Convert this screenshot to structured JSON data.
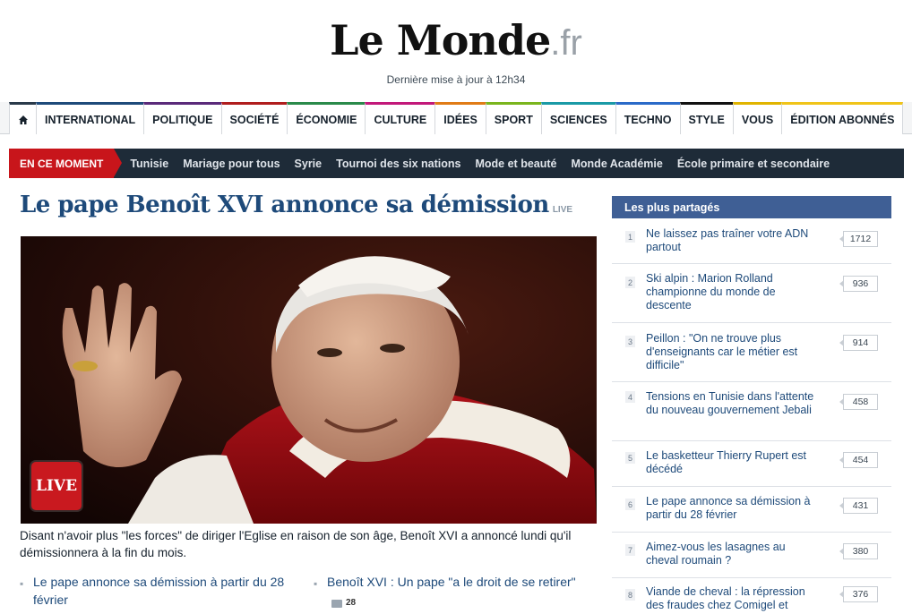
{
  "header": {
    "logo_main": "Le Monde",
    "logo_ext": ".fr",
    "updated": "Dernière mise à jour à 12h34"
  },
  "nav": {
    "home_icon": "home-icon",
    "items": [
      {
        "label": "INTERNATIONAL",
        "color": "#1e4a7a"
      },
      {
        "label": "POLITIQUE",
        "color": "#5a2a7a"
      },
      {
        "label": "SOCIÉTÉ",
        "color": "#b01d1d"
      },
      {
        "label": "ÉCONOMIE",
        "color": "#2a8a4a"
      },
      {
        "label": "CULTURE",
        "color": "#c2187a"
      },
      {
        "label": "IDÉES",
        "color": "#e07b16"
      },
      {
        "label": "SPORT",
        "color": "#7ab51d"
      },
      {
        "label": "SCIENCES",
        "color": "#1a9aa6"
      },
      {
        "label": "TECHNO",
        "color": "#2a6ac8"
      },
      {
        "label": "STYLE",
        "color": "#111111"
      },
      {
        "label": "VOUS",
        "color": "#e0b400"
      },
      {
        "label": "ÉDITION ABONNÉS",
        "color": "#f0c419"
      }
    ]
  },
  "moment": {
    "label": "EN CE MOMENT",
    "links": [
      "Tunisie",
      "Mariage pour tous",
      "Syrie",
      "Tournoi des six nations",
      "Mode et beauté",
      "Monde Académie",
      "École primaire et secondaire"
    ]
  },
  "article": {
    "title": "Le pape Benoît XVI annonce sa démission",
    "title_live": "LIVE",
    "badge": "LIVE",
    "summary": "Disant n'avoir plus \"les forces\" de diriger l'Eglise en raison de son âge, Benoît XVI a annoncé lundi qu'il démissionnera à la fin du mois.",
    "related": [
      {
        "text": "Le pape annonce sa démission à partir du 28 février"
      },
      {
        "text": "Benoît XVI : Un pape \"a le droit de se retirer\"",
        "comments": "28"
      }
    ]
  },
  "sidebar": {
    "title": "Les plus partagés",
    "items": [
      {
        "num": "1",
        "title": "Ne laissez pas traîner votre ADN partout",
        "count": "1712"
      },
      {
        "num": "2",
        "title": "Ski alpin : Marion Rolland championne du monde de descente",
        "count": "936"
      },
      {
        "num": "3",
        "title": "Peillon : \"On ne trouve plus d'enseignants car le métier est difficile\"",
        "count": "914"
      },
      {
        "num": "4",
        "title": "Tensions en Tunisie dans l'attente du nouveau gouvernement Jebali",
        "count": "458"
      },
      {
        "num": "5",
        "title": "Le basketteur Thierry Rupert est décédé",
        "count": "454"
      },
      {
        "num": "6",
        "title": "Le pape annonce sa démission à partir du 28 février",
        "count": "431"
      },
      {
        "num": "7",
        "title": "Aimez-vous les lasagnes au cheval roumain ?",
        "count": "380"
      },
      {
        "num": "8",
        "title": "Viande de cheval : la répression des fraudes chez Comigel et",
        "count": "376"
      }
    ]
  }
}
